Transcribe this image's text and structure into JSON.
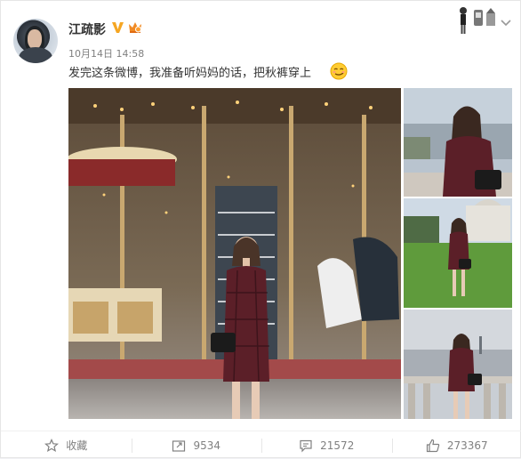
{
  "post": {
    "username": "江疏影",
    "timestamp": "10月14日 14:58",
    "text": "发完这条微博，我准备听妈妈的话，把秋裤穿上",
    "emoji": "smirk-emoji"
  },
  "icons": {
    "verify": "verified-v-icon",
    "vip": "vip-crown-icon",
    "more": "chevron-down-icon",
    "favorite": "star-icon",
    "repost": "repost-icon",
    "comment": "comment-icon",
    "like": "thumbs-up-icon"
  },
  "photos": [
    {
      "name": "carousel-photo"
    },
    {
      "name": "city-overlook-photo"
    },
    {
      "name": "lawn-photo"
    },
    {
      "name": "balustrade-photo"
    }
  ],
  "actions": {
    "favorite_label": "收藏",
    "repost_count": "9534",
    "comment_count": "21572",
    "like_count": "273367"
  },
  "colors": {
    "verify_gold": "#f5a623",
    "text": "#333333",
    "muted": "#808080"
  }
}
